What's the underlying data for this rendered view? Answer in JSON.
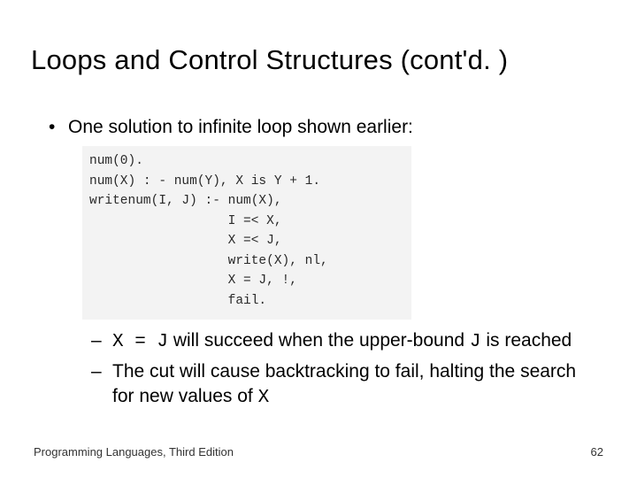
{
  "title": "Loops and Control Structures (cont'd. )",
  "bullet1": "One solution to infinite loop shown earlier:",
  "code": "num(0).\nnum(X) : - num(Y), X is Y + 1.\nwritenum(I, J) :- num(X),\n                  I =< X,\n                  X =< J,\n                  write(X), nl,\n                  X = J, !,\n                  fail.",
  "sub1_code": "X = J",
  "sub1_mid": " will succeed when the upper-bound ",
  "sub1_code2": "J",
  "sub1_tail": " is reached",
  "sub2_pre": "The cut will cause backtracking to fail, halting the search for new values of ",
  "sub2_code": "X",
  "footer_left": "Programming Languages, Third Edition",
  "footer_right": "62"
}
